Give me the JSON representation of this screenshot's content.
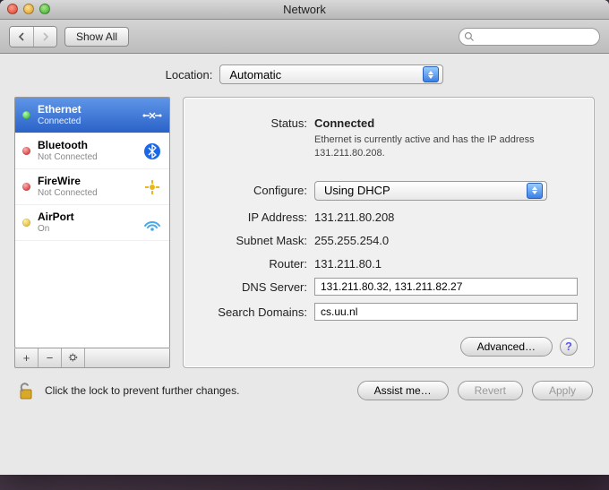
{
  "window_title": "Network",
  "toolbar": {
    "show_all_label": "Show All"
  },
  "location": {
    "label": "Location:",
    "value": "Automatic"
  },
  "sidebar": {
    "services": [
      {
        "name": "Ethernet",
        "sub": "Connected",
        "dot": "green",
        "icon": "ethernet",
        "selected": true
      },
      {
        "name": "Bluetooth",
        "sub": "Not Connected",
        "dot": "red",
        "icon": "bluetooth",
        "selected": false
      },
      {
        "name": "FireWire",
        "sub": "Not Connected",
        "dot": "red",
        "icon": "firewire",
        "selected": false
      },
      {
        "name": "AirPort",
        "sub": "On",
        "dot": "yellow",
        "icon": "airport",
        "selected": false
      }
    ]
  },
  "detail": {
    "status_label": "Status:",
    "status_value": "Connected",
    "status_desc": "Ethernet is currently active and has the IP address 131.211.80.208.",
    "configure_label": "Configure:",
    "configure_value": "Using DHCP",
    "ip_label": "IP Address:",
    "ip_value": "131.211.80.208",
    "mask_label": "Subnet Mask:",
    "mask_value": "255.255.254.0",
    "router_label": "Router:",
    "router_value": "131.211.80.1",
    "dns_label": "DNS Server:",
    "dns_value": "131.211.80.32, 131.211.82.27",
    "search_label": "Search Domains:",
    "search_value": "cs.uu.nl",
    "advanced_label": "Advanced…"
  },
  "bottom": {
    "lock_msg": "Click the lock to prevent further changes.",
    "assist_label": "Assist me…",
    "revert_label": "Revert",
    "apply_label": "Apply"
  }
}
